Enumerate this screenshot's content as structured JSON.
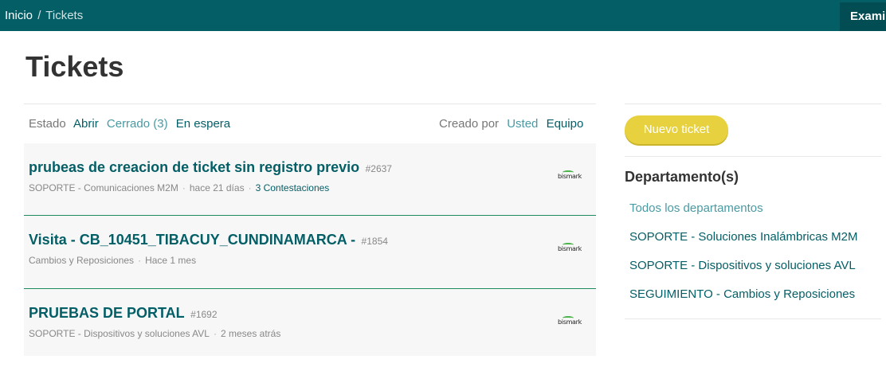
{
  "breadcrumb": {
    "home": "Inicio",
    "separator": "/",
    "current": "Tickets"
  },
  "header": {
    "search_button": "Examinar"
  },
  "page": {
    "title": "Tickets"
  },
  "filters": {
    "status_label": "Estado",
    "status_options": [
      "Abrir",
      "Cerrado (3)",
      "En espera"
    ],
    "created_by_label": "Creado por",
    "created_by_options": [
      "Usted",
      "Equipo"
    ]
  },
  "tickets": [
    {
      "title": "prubeas de creacion de ticket sin registro previo",
      "number": "#2637",
      "department": "SOPORTE - Comunicaciones M2M",
      "time": "hace 21 días",
      "replies": "3 Contestaciones",
      "logo": "bismark"
    },
    {
      "title": "Visita - CB_10451_TIBACUY_CUNDINAMARCA -",
      "number": "#1854",
      "department": "Cambios y Reposiciones",
      "time": "Hace 1 mes",
      "logo": "bismark"
    },
    {
      "title": "PRUEBAS DE PORTAL",
      "number": "#1692",
      "department": "SOPORTE - Dispositivos y soluciones AVL",
      "time": "2 meses atrás",
      "logo": "bismark"
    }
  ],
  "sidebar": {
    "new_ticket_button": "Nuevo ticket",
    "departments_heading": "Departamento(s)",
    "departments": [
      "Todos los departamentos",
      "SOPORTE - Soluciones Inalámbricas M2M",
      "SOPORTE - Dispositivos y soluciones AVL",
      "SEGUIMIENTO - Cambios y Reposiciones"
    ]
  },
  "colors": {
    "topbar": "#035e66",
    "accent_teal": "#035e66",
    "link_light": "#4a9aa3",
    "button_yellow": "#e7d13f",
    "row_border_green": "#1f8a5e"
  }
}
